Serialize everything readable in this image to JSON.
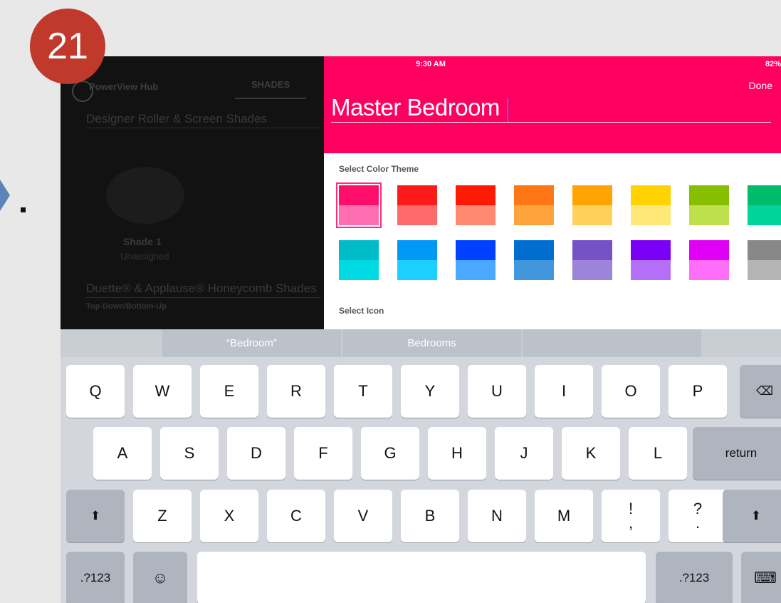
{
  "step_number": "21",
  "left_panel": {
    "hub_label": "PowerView Hub",
    "tab_label": "SHADES",
    "section1_title": "Designer Roller & Screen Shades",
    "shade_name": "Shade 1",
    "shade_status": "Unassigned",
    "section2_title": "Duette® & Applause® Honeycomb Shades",
    "section2_subtitle": "Top-Down/Bottom-Up"
  },
  "status_bar": {
    "time": "9:30 AM",
    "battery": "82%"
  },
  "editor": {
    "done_label": "Done",
    "room_name": "Master Bedroom",
    "color_theme_label": "Select Color Theme",
    "icon_label": "Select Icon",
    "selected_color_index": 0,
    "colors": [
      {
        "top": "#ff0f6b",
        "bottom": "#ff6eb0"
      },
      {
        "top": "#ff1a1a",
        "bottom": "#ff6a6a"
      },
      {
        "top": "#ff1a05",
        "bottom": "#ff8a70"
      },
      {
        "top": "#ff7715",
        "bottom": "#ffa33c"
      },
      {
        "top": "#ffa400",
        "bottom": "#ffd05a"
      },
      {
        "top": "#ffd200",
        "bottom": "#ffe878"
      },
      {
        "top": "#86bf00",
        "bottom": "#bde04c"
      },
      {
        "top": "#00bb6a",
        "bottom": "#00d49a"
      },
      {
        "top": "#00bcc8",
        "bottom": "#00dbe3"
      },
      {
        "top": "#0099f6",
        "bottom": "#1ccfff"
      },
      {
        "top": "#0040ff",
        "bottom": "#4aa8ff"
      },
      {
        "top": "#006ecf",
        "bottom": "#4297dc"
      },
      {
        "top": "#7552c6",
        "bottom": "#9d84db"
      },
      {
        "top": "#7b00f6",
        "bottom": "#b46ff6"
      },
      {
        "top": "#e100f6",
        "bottom": "#ff6ef8"
      },
      {
        "top": "#888888",
        "bottom": "#b4b4b4"
      }
    ]
  },
  "keyboard": {
    "suggestions": [
      "“Bedroom”",
      "Bedrooms",
      ""
    ],
    "row1": [
      "Q",
      "W",
      "E",
      "R",
      "T",
      "Y",
      "U",
      "I",
      "O",
      "P"
    ],
    "row2": [
      "A",
      "S",
      "D",
      "F",
      "G",
      "H",
      "J",
      "K",
      "L"
    ],
    "row3": [
      "Z",
      "X",
      "C",
      "V",
      "B",
      "N",
      "M"
    ],
    "exclaim": "!\n,",
    "question": "?\n.",
    "return_label": "return",
    "numbers_label": ".?123",
    "emoji": "☺",
    "backspace": "⌫",
    "shift": "⬆",
    "hide_keyboard": "⌨"
  }
}
